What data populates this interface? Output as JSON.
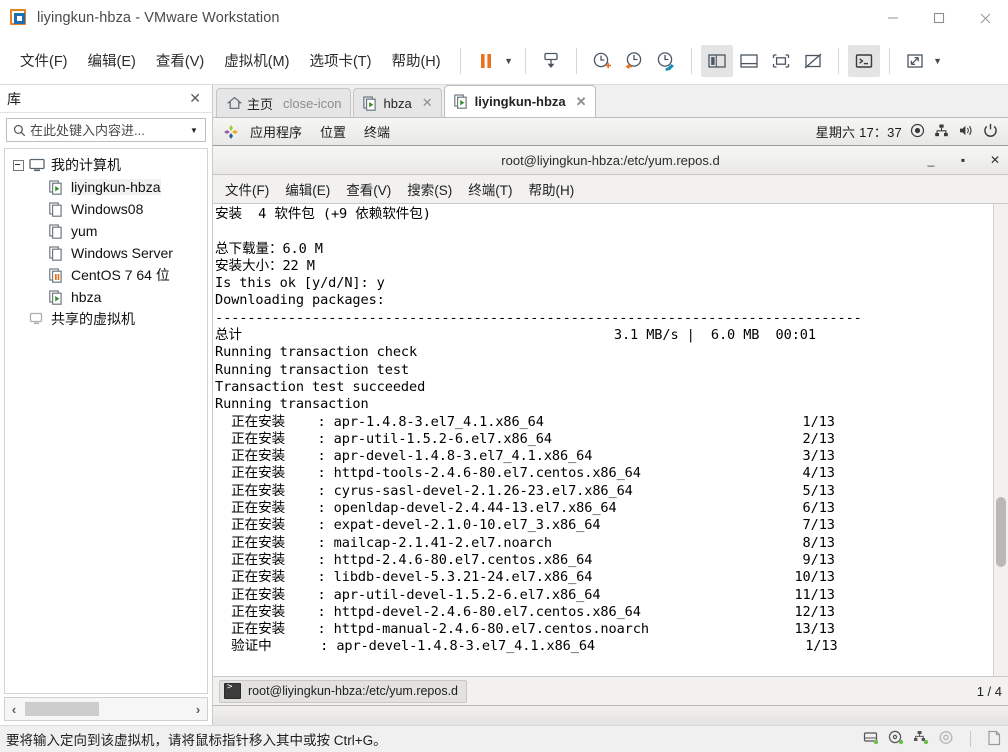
{
  "window": {
    "title": "liyingkun-hbza - VMware Workstation",
    "app_icon": "vmware-logo-icon",
    "controls": [
      {
        "name": "minimize-button",
        "glyph": "minimize-icon"
      },
      {
        "name": "maximize-button",
        "glyph": "maximize-icon"
      },
      {
        "name": "close-button",
        "glyph": "close-icon"
      }
    ]
  },
  "menubar": {
    "items": [
      {
        "label": "文件(F)",
        "name": "menu-file"
      },
      {
        "label": "编辑(E)",
        "name": "menu-edit"
      },
      {
        "label": "查看(V)",
        "name": "menu-view"
      },
      {
        "label": "虚拟机(M)",
        "name": "menu-vm"
      },
      {
        "label": "选项卡(T)",
        "name": "menu-tabs"
      },
      {
        "label": "帮助(H)",
        "name": "menu-help"
      }
    ]
  },
  "toolbar": {
    "items": [
      {
        "name": "suspend-button",
        "icon": "pause-icon",
        "color": "#e8721f"
      },
      {
        "name": "suspend-dropdown",
        "icon": "caret-down-icon"
      },
      {
        "name": "power-button",
        "icon": "power-down-icon"
      },
      {
        "name": "snapshot-button",
        "icon": "snapshot-clock-icon"
      },
      {
        "name": "revert-snapshot-button",
        "icon": "revert-clock-icon"
      },
      {
        "name": "snapshot-manager-button",
        "icon": "clock-wrench-icon"
      },
      {
        "name": "show-library-button",
        "icon": "panel-left-icon",
        "pressed": true
      },
      {
        "name": "show-thumbnails-button",
        "icon": "panel-bottom-icon"
      },
      {
        "name": "full-screen-button",
        "icon": "expand-frame-icon"
      },
      {
        "name": "unity-button",
        "icon": "frame-slash-icon"
      },
      {
        "name": "console-view-button",
        "icon": "terminal-icon",
        "pressed": true
      },
      {
        "name": "stretch-button",
        "icon": "arrows-diagonal-icon"
      },
      {
        "name": "stretch-dropdown",
        "icon": "caret-down-icon"
      }
    ]
  },
  "sidebar": {
    "title": "库",
    "close_label": "✕",
    "search": {
      "placeholder": "在此处键入内容进...",
      "value": "",
      "icon": "search-icon",
      "dropdown_icon": "caret-down-icon"
    },
    "tree": [
      {
        "label": "我的计算机",
        "icon": "my-computer-icon",
        "level": 0,
        "expanded": true,
        "name": "sidebar-item-my-computer"
      },
      {
        "label": "liyingkun-hbza",
        "icon": "vm-running-icon",
        "level": 1,
        "selected": true,
        "name": "sidebar-item-liyingkun-hbza"
      },
      {
        "label": "Windows08",
        "icon": "vm-off-icon",
        "level": 1,
        "name": "sidebar-item-windows08"
      },
      {
        "label": "yum",
        "icon": "vm-off-icon",
        "level": 1,
        "name": "sidebar-item-yum"
      },
      {
        "label": "Windows Server ",
        "icon": "vm-off-icon",
        "level": 1,
        "name": "sidebar-item-windows-server"
      },
      {
        "label": "CentOS 7 64 位",
        "icon": "vm-suspended-icon",
        "level": 1,
        "name": "sidebar-item-centos7"
      },
      {
        "label": "hbza",
        "icon": "vm-running-icon",
        "level": 1,
        "name": "sidebar-item-hbza"
      },
      {
        "label": "共享的虚拟机",
        "icon": "shared-vms-icon",
        "level": 0,
        "name": "sidebar-item-shared-vms"
      }
    ],
    "hscroll": {
      "left_arrow": "‹",
      "right_arrow": "›"
    }
  },
  "tabs": [
    {
      "label": "主页",
      "icon": "home-icon",
      "active": false,
      "close_icon": "close-icon",
      "name": "tab-home"
    },
    {
      "label": "hbza",
      "icon": "vm-running-icon",
      "active": false,
      "close_icon": "close-icon",
      "name": "tab-hbza"
    },
    {
      "label": "liyingkun-hbza",
      "icon": "vm-running-icon",
      "active": true,
      "close_icon": "close-icon",
      "name": "tab-liyingkun-hbza"
    }
  ],
  "guest": {
    "panel": {
      "logo_icon": "centos-logo-icon",
      "menus": [
        {
          "label": "应用程序",
          "name": "gnome-menu-applications"
        },
        {
          "label": "位置",
          "name": "gnome-menu-places"
        },
        {
          "label": "终端",
          "name": "gnome-menu-terminal"
        }
      ],
      "clock": "星期六 17：37",
      "tray": [
        {
          "name": "record-indicator-icon",
          "icon": "target-icon"
        },
        {
          "name": "network-icon",
          "icon": "network-icon"
        },
        {
          "name": "volume-icon",
          "icon": "speaker-icon"
        },
        {
          "name": "power-menu-icon",
          "icon": "power-icon"
        }
      ]
    },
    "terminal": {
      "title": "root@liyingkun-hbza:/etc/yum.repos.d",
      "controls": [
        {
          "name": "terminal-minimize-button",
          "glyph": "_"
        },
        {
          "name": "terminal-maximize-button",
          "glyph": "▪"
        },
        {
          "name": "terminal-close-button",
          "glyph": "✕"
        }
      ],
      "menus": [
        {
          "label": "文件(F)",
          "name": "terminal-menu-file"
        },
        {
          "label": "编辑(E)",
          "name": "terminal-menu-edit"
        },
        {
          "label": "查看(V)",
          "name": "terminal-menu-view"
        },
        {
          "label": "搜索(S)",
          "name": "terminal-menu-search"
        },
        {
          "label": "终端(T)",
          "name": "terminal-menu-terminal"
        },
        {
          "label": "帮助(H)",
          "name": "terminal-menu-help"
        }
      ],
      "output": "安装  4 软件包 (+9 依赖软件包)\n\n总下载量：6.0 M\n安装大小：22 M\nIs this ok [y/d/N]: y\nDownloading packages:\n--------------------------------------------------------------------------------\n总计                                              3.1 MB/s |  6.0 MB  00:01\nRunning transaction check\nRunning transaction test\nTransaction test succeeded\nRunning transaction\n  正在安装    : apr-1.4.8-3.el7_4.1.x86_64                                1/13\n  正在安装    : apr-util-1.5.2-6.el7.x86_64                               2/13\n  正在安装    : apr-devel-1.4.8-3.el7_4.1.x86_64                          3/13\n  正在安装    : httpd-tools-2.4.6-80.el7.centos.x86_64                    4/13\n  正在安装    : cyrus-sasl-devel-2.1.26-23.el7.x86_64                     5/13\n  正在安装    : openldap-devel-2.4.44-13.el7.x86_64                       6/13\n  正在安装    : expat-devel-2.1.0-10.el7_3.x86_64                         7/13\n  正在安装    : mailcap-2.1.41-2.el7.noarch                               8/13\n  正在安装    : httpd-2.4.6-80.el7.centos.x86_64                          9/13\n  正在安装    : libdb-devel-5.3.21-24.el7.x86_64                         10/13\n  正在安装    : apr-util-devel-1.5.2-6.el7.x86_64                        11/13\n  正在安装    : httpd-devel-2.4.6-80.el7.centos.x86_64                   12/13\n  正在安装    : httpd-manual-2.4.6-80.el7.centos.noarch                  13/13\n  验证中      : apr-devel-1.4.8-3.el7_4.1.x86_64                          1/13",
      "status": {
        "tab_label": "root@liyingkun-hbza:/etc/yum.repos.d",
        "tab_icon": "terminal-icon",
        "page_indicator": "1 / 4"
      },
      "scrollbar": {
        "name": "terminal-scrollbar"
      }
    }
  },
  "statusbar": {
    "message": "要将输入定向到该虚拟机，请将鼠标指针移入其中或按 Ctrl+G。",
    "icons": [
      {
        "name": "hard-disk-status-icon",
        "icon": "disk-icon",
        "active": true
      },
      {
        "name": "cd-dvd-status-icon",
        "icon": "cd-icon",
        "active": true
      },
      {
        "name": "network-status-icon",
        "icon": "network-icon",
        "active": true
      },
      {
        "name": "usb-status-icon",
        "icon": "usb-icon",
        "active": false
      },
      {
        "name": "printer-status-icon",
        "icon": "document-icon",
        "active": false
      }
    ]
  },
  "colors": {
    "accent_orange": "#e8721f",
    "accent_blue": "#1a6fb5",
    "vm_green": "#3a8f2a",
    "window_bg": "#f0f0f0",
    "terminal_bg": "#ffffff",
    "terminal_fg": "#000000"
  }
}
